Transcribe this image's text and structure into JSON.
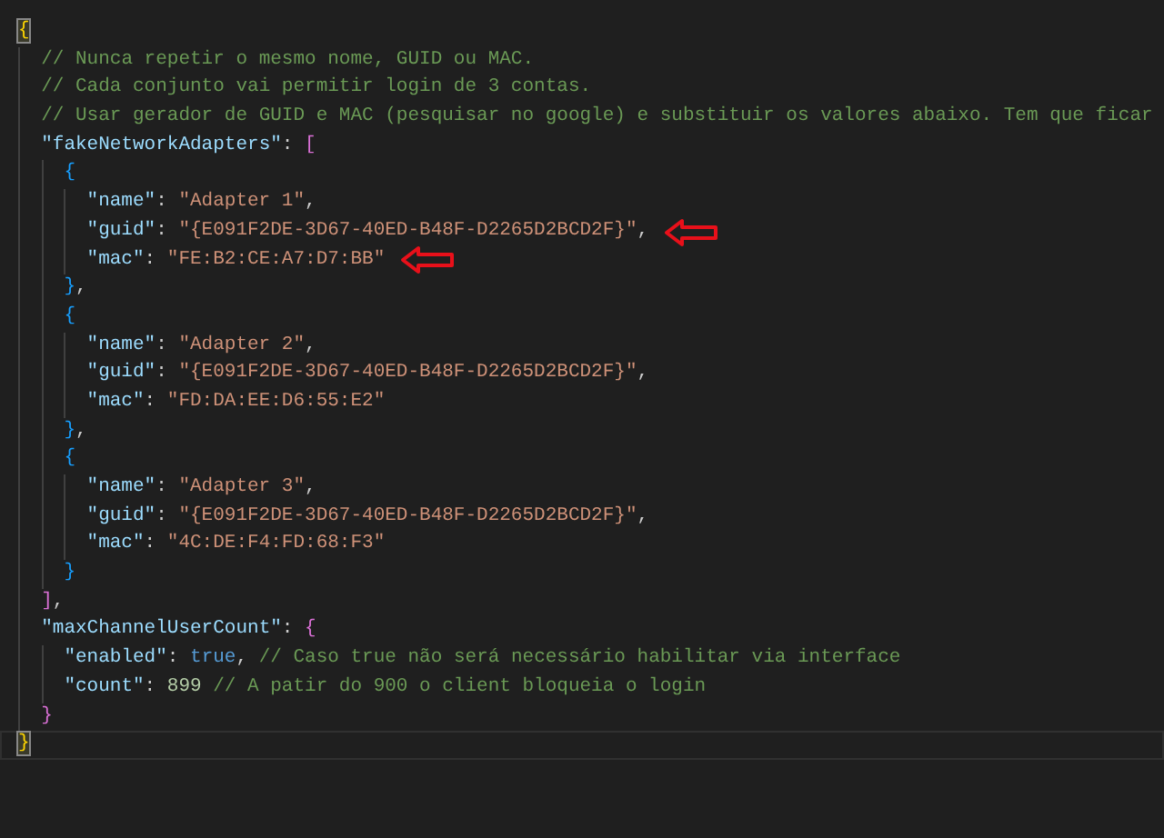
{
  "editor": {
    "lines": [
      {
        "current": false,
        "tokens": [
          {
            "kind": "bracket",
            "text": "{",
            "matched": true
          }
        ],
        "children": [
          {
            "current": false,
            "tokens": [
              {
                "kind": "comment",
                "text": "// Nunca repetir o mesmo nome, GUID ou MAC."
              }
            ]
          },
          {
            "current": false,
            "tokens": [
              {
                "kind": "comment",
                "text": "// Cada conjunto vai permitir login de 3 contas."
              }
            ]
          },
          {
            "current": false,
            "tokens": [
              {
                "kind": "comment",
                "text": "// Usar gerador de GUID e MAC (pesquisar no google) e substituir os valores abaixo. Tem que ficar"
              }
            ]
          },
          {
            "current": false,
            "tokens": [
              {
                "kind": "key",
                "text": "\"fakeNetworkAdapters\""
              },
              {
                "kind": "colon",
                "text": ":"
              },
              {
                "kind": "bracket",
                "text": "[",
                "matched": false
              }
            ],
            "children": [
              {
                "current": false,
                "tokens": [
                  {
                    "kind": "bracket",
                    "text": "{",
                    "matched": false
                  }
                ],
                "children": [
                  {
                    "current": false,
                    "tokens": [
                      {
                        "kind": "key",
                        "text": "\"name\""
                      },
                      {
                        "kind": "colon",
                        "text": ":"
                      },
                      {
                        "kind": "string",
                        "text": "\"Adapter 1\""
                      },
                      {
                        "kind": "comma",
                        "text": ","
                      }
                    ]
                  },
                  {
                    "current": false,
                    "arrow": true,
                    "tokens": [
                      {
                        "kind": "key",
                        "text": "\"guid\""
                      },
                      {
                        "kind": "colon",
                        "text": ":"
                      },
                      {
                        "kind": "string",
                        "text": "\"{E091F2DE-3D67-40ED-B48F-D2265D2BCD2F}\""
                      },
                      {
                        "kind": "comma",
                        "text": ","
                      }
                    ]
                  },
                  {
                    "current": false,
                    "arrow": true,
                    "tokens": [
                      {
                        "kind": "key",
                        "text": "\"mac\""
                      },
                      {
                        "kind": "colon",
                        "text": ":"
                      },
                      {
                        "kind": "string",
                        "text": "\"FE:B2:CE:A7:D7:BB\""
                      }
                    ]
                  }
                ]
              },
              {
                "current": false,
                "tokens": [
                  {
                    "kind": "bracket",
                    "text": "}",
                    "matched": false
                  },
                  {
                    "kind": "comma",
                    "text": ","
                  }
                ]
              },
              {
                "current": false,
                "tokens": [
                  {
                    "kind": "bracket",
                    "text": "{",
                    "matched": false
                  }
                ],
                "children": [
                  {
                    "current": false,
                    "tokens": [
                      {
                        "kind": "key",
                        "text": "\"name\""
                      },
                      {
                        "kind": "colon",
                        "text": ":"
                      },
                      {
                        "kind": "string",
                        "text": "\"Adapter 2\""
                      },
                      {
                        "kind": "comma",
                        "text": ","
                      }
                    ]
                  },
                  {
                    "current": false,
                    "tokens": [
                      {
                        "kind": "key",
                        "text": "\"guid\""
                      },
                      {
                        "kind": "colon",
                        "text": ":"
                      },
                      {
                        "kind": "string",
                        "text": "\"{E091F2DE-3D67-40ED-B48F-D2265D2BCD2F}\""
                      },
                      {
                        "kind": "comma",
                        "text": ","
                      }
                    ]
                  },
                  {
                    "current": false,
                    "tokens": [
                      {
                        "kind": "key",
                        "text": "\"mac\""
                      },
                      {
                        "kind": "colon",
                        "text": ":"
                      },
                      {
                        "kind": "string",
                        "text": "\"FD:DA:EE:D6:55:E2\""
                      }
                    ]
                  }
                ]
              },
              {
                "current": false,
                "tokens": [
                  {
                    "kind": "bracket",
                    "text": "}",
                    "matched": false
                  },
                  {
                    "kind": "comma",
                    "text": ","
                  }
                ]
              },
              {
                "current": false,
                "tokens": [
                  {
                    "kind": "bracket",
                    "text": "{",
                    "matched": false
                  }
                ],
                "children": [
                  {
                    "current": false,
                    "tokens": [
                      {
                        "kind": "key",
                        "text": "\"name\""
                      },
                      {
                        "kind": "colon",
                        "text": ":"
                      },
                      {
                        "kind": "string",
                        "text": "\"Adapter 3\""
                      },
                      {
                        "kind": "comma",
                        "text": ","
                      }
                    ]
                  },
                  {
                    "current": false,
                    "tokens": [
                      {
                        "kind": "key",
                        "text": "\"guid\""
                      },
                      {
                        "kind": "colon",
                        "text": ":"
                      },
                      {
                        "kind": "string",
                        "text": "\"{E091F2DE-3D67-40ED-B48F-D2265D2BCD2F}\""
                      },
                      {
                        "kind": "comma",
                        "text": ","
                      }
                    ]
                  },
                  {
                    "current": false,
                    "tokens": [
                      {
                        "kind": "key",
                        "text": "\"mac\""
                      },
                      {
                        "kind": "colon",
                        "text": ":"
                      },
                      {
                        "kind": "string",
                        "text": "\"4C:DE:F4:FD:68:F3\""
                      }
                    ]
                  }
                ]
              },
              {
                "current": false,
                "tokens": [
                  {
                    "kind": "bracket",
                    "text": "}",
                    "matched": false
                  }
                ]
              }
            ]
          },
          {
            "current": false,
            "tokens": [
              {
                "kind": "bracket",
                "text": "]",
                "matched": false
              },
              {
                "kind": "comma",
                "text": ","
              }
            ]
          },
          {
            "current": false,
            "tokens": [
              {
                "kind": "key",
                "text": "\"maxChannelUserCount\""
              },
              {
                "kind": "colon",
                "text": ":"
              },
              {
                "kind": "bracket",
                "text": "{",
                "matched": false
              }
            ],
            "children": [
              {
                "current": false,
                "tokens": [
                  {
                    "kind": "key",
                    "text": "\"enabled\""
                  },
                  {
                    "kind": "colon",
                    "text": ":"
                  },
                  {
                    "kind": "keyword",
                    "text": "true"
                  },
                  {
                    "kind": "comma",
                    "text": ","
                  },
                  {
                    "kind": "comment",
                    "text": "// Caso true não será necessário habilitar via interface"
                  }
                ]
              },
              {
                "current": false,
                "tokens": [
                  {
                    "kind": "key",
                    "text": "\"count\""
                  },
                  {
                    "kind": "colon",
                    "text": ":"
                  },
                  {
                    "kind": "number",
                    "text": "899"
                  },
                  {
                    "kind": "comment",
                    "text": "// A patir do 900 o client bloqueia o login"
                  }
                ]
              }
            ]
          },
          {
            "current": false,
            "tokens": [
              {
                "kind": "bracket",
                "text": "}",
                "matched": false
              }
            ]
          }
        ]
      },
      {
        "current": true,
        "tokens": [
          {
            "kind": "bracket",
            "text": "}",
            "matched": true
          }
        ]
      }
    ]
  }
}
